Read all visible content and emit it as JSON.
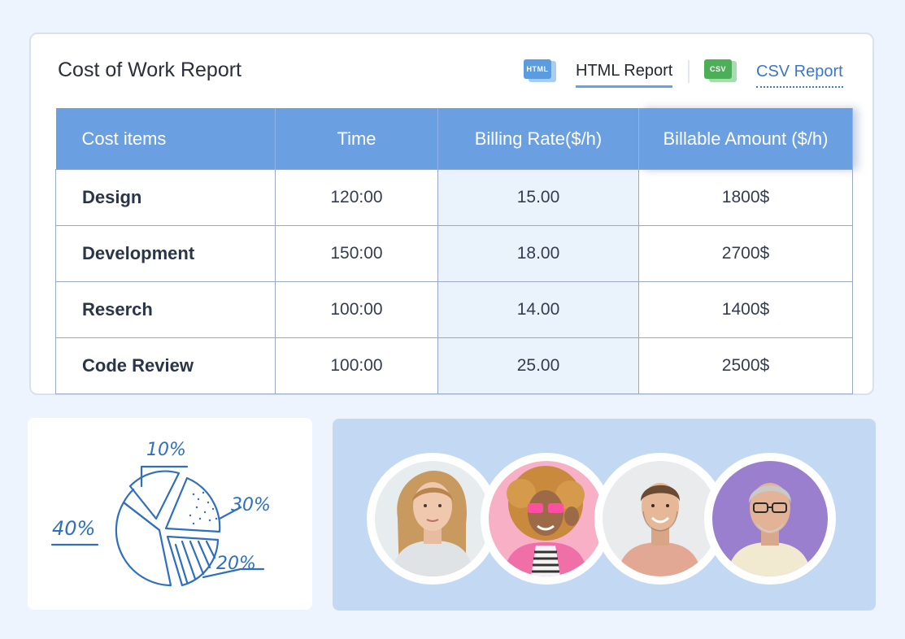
{
  "report": {
    "title": "Cost of Work Report",
    "tabs": [
      {
        "label": "HTML Report",
        "icon": "html-file-icon",
        "icon_text": "HTML",
        "color": "#5b9be0"
      },
      {
        "label": "CSV Report",
        "icon": "csv-file-icon",
        "icon_text": "CSV",
        "color": "#4caf58"
      }
    ]
  },
  "table": {
    "headers": [
      "Cost items",
      "Time",
      "Billing Rate($/h)",
      "Billable Amount ($/h)"
    ],
    "rows": [
      {
        "item": "Design",
        "time": "120:00",
        "rate": "15.00",
        "amount": "1800$"
      },
      {
        "item": "Development",
        "time": "150:00",
        "rate": "18.00",
        "amount": "2700$"
      },
      {
        "item": "Reserch",
        "time": "100:00",
        "rate": "14.00",
        "amount": "1400$"
      },
      {
        "item": "Code Review",
        "time": "100:00",
        "rate": "25.00",
        "amount": "2500$"
      }
    ]
  },
  "sketch": {
    "labels": [
      "10%",
      "30%",
      "40%",
      "20%"
    ],
    "color": "#2f6fbe"
  },
  "people": {
    "avatars": [
      "avatar-woman-blonde",
      "avatar-woman-curly-pink-glasses",
      "avatar-man-smiling",
      "avatar-man-grey-glasses"
    ]
  }
}
